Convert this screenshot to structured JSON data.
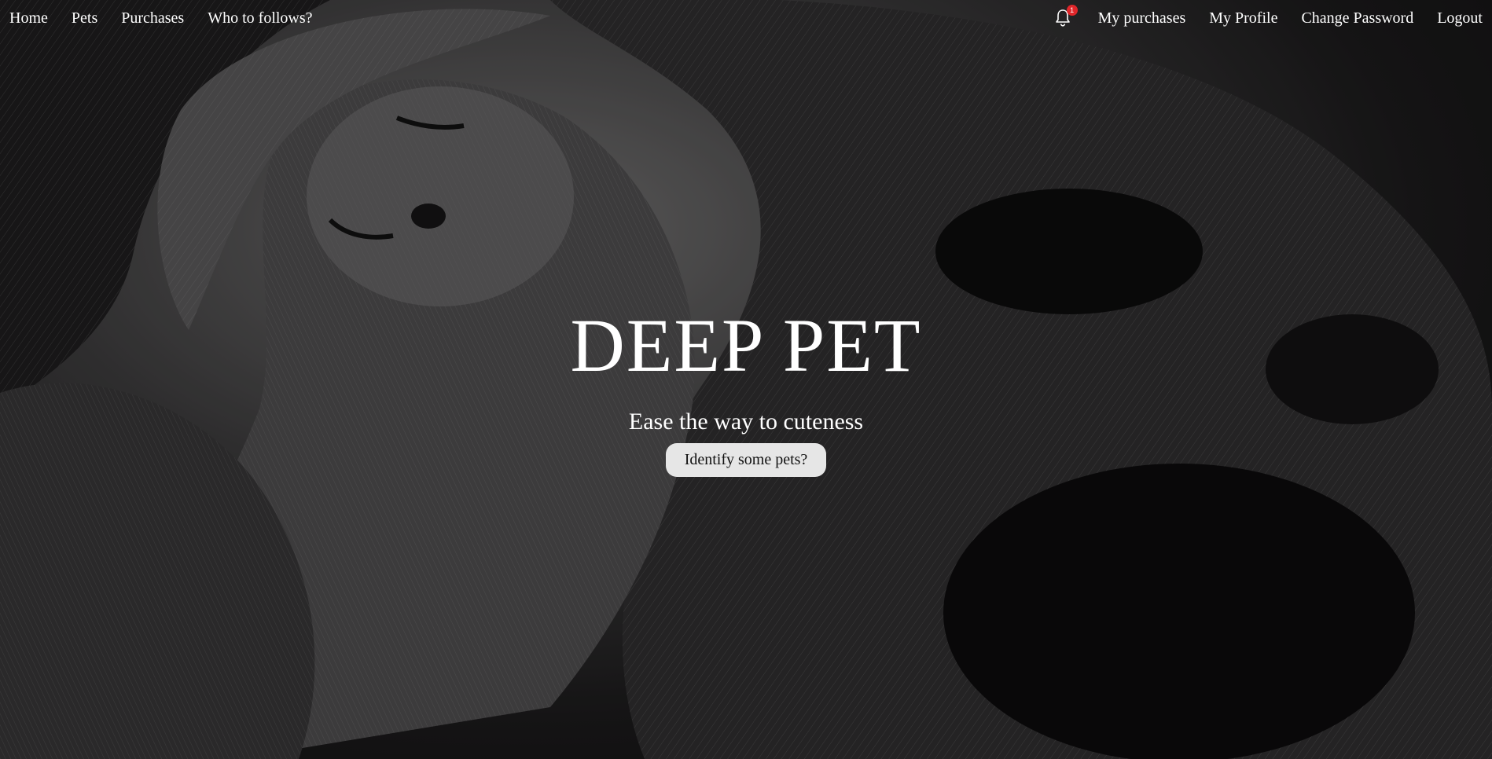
{
  "nav": {
    "left": [
      {
        "label": "Home"
      },
      {
        "label": "Pets"
      },
      {
        "label": "Purchases"
      },
      {
        "label": "Who to follows?"
      }
    ],
    "notification_count": "1",
    "right": [
      {
        "label": "My purchases"
      },
      {
        "label": "My Profile"
      },
      {
        "label": "Change Password"
      },
      {
        "label": "Logout"
      }
    ]
  },
  "hero": {
    "title": "DEEP PET",
    "subtitle": "Ease the way to cuteness",
    "cta_label": "Identify some pets?"
  },
  "colors": {
    "badge": "#e0262a",
    "button_bg": "#e6e6e6",
    "text": "#ffffff"
  },
  "icons": {
    "notifications": "bell-icon"
  }
}
